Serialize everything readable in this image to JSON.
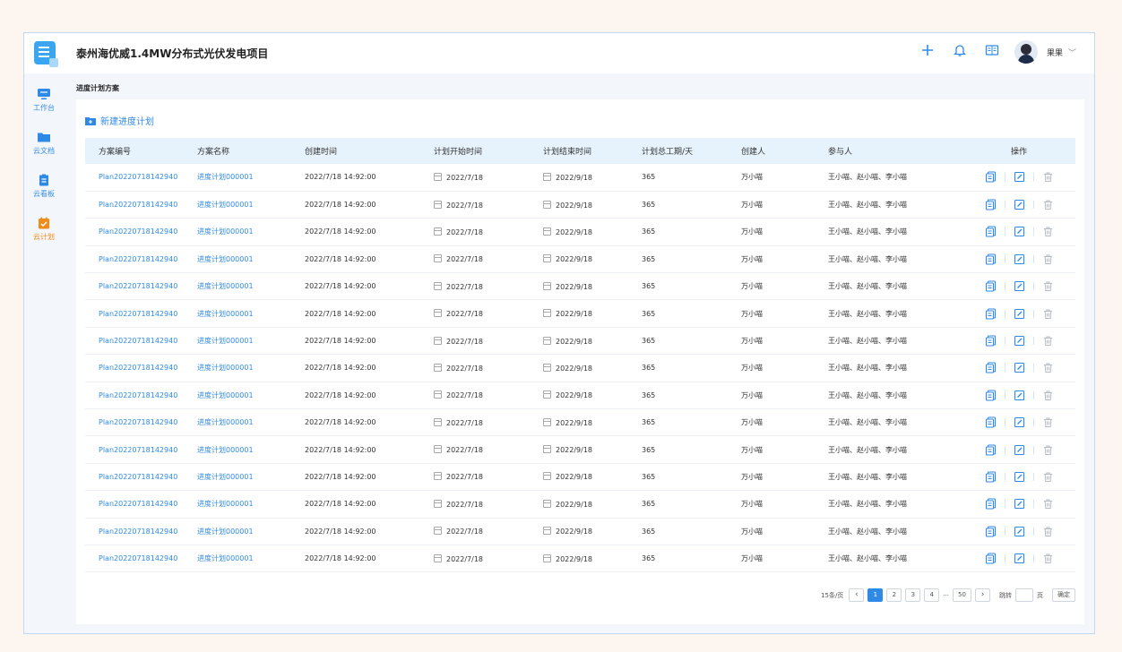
{
  "header": {
    "project_title": "泰州海优威1.4MW分布式光伏发电项目",
    "user_name": "果果"
  },
  "sidebar": {
    "items": [
      {
        "label": "工作台",
        "icon": "monitor-icon",
        "active": false
      },
      {
        "label": "云文档",
        "icon": "folder-icon",
        "active": false
      },
      {
        "label": "云看板",
        "icon": "clipboard-icon",
        "active": false
      },
      {
        "label": "云计划",
        "icon": "calendar-check-icon",
        "active": true
      }
    ]
  },
  "breadcrumb": "进度计划方案",
  "new_plan_label": "新建进度计划",
  "table": {
    "columns": [
      "方案编号",
      "方案名称",
      "创建时间",
      "计划开始时间",
      "计划结束时间",
      "计划总工期/天",
      "创建人",
      "参与人",
      "操作"
    ],
    "rows": [
      {
        "id": "Plan20220718142940",
        "name": "进度计划000001",
        "created": "2022/7/18  14:92:00",
        "start": "2022/7/18",
        "end": "2022/9/18",
        "duration": "365",
        "creator": "万小喵",
        "participants": "王小喵、赵小喵、李小喵"
      },
      {
        "id": "Plan20220718142940",
        "name": "进度计划000001",
        "created": "2022/7/18  14:92:00",
        "start": "2022/7/18",
        "end": "2022/9/18",
        "duration": "365",
        "creator": "万小喵",
        "participants": "王小喵、赵小喵、李小喵"
      },
      {
        "id": "Plan20220718142940",
        "name": "进度计划000001",
        "created": "2022/7/18  14:92:00",
        "start": "2022/7/18",
        "end": "2022/9/18",
        "duration": "365",
        "creator": "万小喵",
        "participants": "王小喵、赵小喵、李小喵"
      },
      {
        "id": "Plan20220718142940",
        "name": "进度计划000001",
        "created": "2022/7/18  14:92:00",
        "start": "2022/7/18",
        "end": "2022/9/18",
        "duration": "365",
        "creator": "万小喵",
        "participants": "王小喵、赵小喵、李小喵"
      },
      {
        "id": "Plan20220718142940",
        "name": "进度计划000001",
        "created": "2022/7/18  14:92:00",
        "start": "2022/7/18",
        "end": "2022/9/18",
        "duration": "365",
        "creator": "万小喵",
        "participants": "王小喵、赵小喵、李小喵"
      },
      {
        "id": "Plan20220718142940",
        "name": "进度计划000001",
        "created": "2022/7/18  14:92:00",
        "start": "2022/7/18",
        "end": "2022/9/18",
        "duration": "365",
        "creator": "万小喵",
        "participants": "王小喵、赵小喵、李小喵"
      },
      {
        "id": "Plan20220718142940",
        "name": "进度计划000001",
        "created": "2022/7/18  14:92:00",
        "start": "2022/7/18",
        "end": "2022/9/18",
        "duration": "365",
        "creator": "万小喵",
        "participants": "王小喵、赵小喵、李小喵"
      },
      {
        "id": "Plan20220718142940",
        "name": "进度计划000001",
        "created": "2022/7/18  14:92:00",
        "start": "2022/7/18",
        "end": "2022/9/18",
        "duration": "365",
        "creator": "万小喵",
        "participants": "王小喵、赵小喵、李小喵"
      },
      {
        "id": "Plan20220718142940",
        "name": "进度计划000001",
        "created": "2022/7/18  14:92:00",
        "start": "2022/7/18",
        "end": "2022/9/18",
        "duration": "365",
        "creator": "万小喵",
        "participants": "王小喵、赵小喵、李小喵"
      },
      {
        "id": "Plan20220718142940",
        "name": "进度计划000001",
        "created": "2022/7/18  14:92:00",
        "start": "2022/7/18",
        "end": "2022/9/18",
        "duration": "365",
        "creator": "万小喵",
        "participants": "王小喵、赵小喵、李小喵"
      },
      {
        "id": "Plan20220718142940",
        "name": "进度计划000001",
        "created": "2022/7/18  14:92:00",
        "start": "2022/7/18",
        "end": "2022/9/18",
        "duration": "365",
        "creator": "万小喵",
        "participants": "王小喵、赵小喵、李小喵"
      },
      {
        "id": "Plan20220718142940",
        "name": "进度计划000001",
        "created": "2022/7/18  14:92:00",
        "start": "2022/7/18",
        "end": "2022/9/18",
        "duration": "365",
        "creator": "万小喵",
        "participants": "王小喵、赵小喵、李小喵"
      },
      {
        "id": "Plan20220718142940",
        "name": "进度计划000001",
        "created": "2022/7/18  14:92:00",
        "start": "2022/7/18",
        "end": "2022/9/18",
        "duration": "365",
        "creator": "万小喵",
        "participants": "王小喵、赵小喵、李小喵"
      },
      {
        "id": "Plan20220718142940",
        "name": "进度计划000001",
        "created": "2022/7/18  14:92:00",
        "start": "2022/7/18",
        "end": "2022/9/18",
        "duration": "365",
        "creator": "万小喵",
        "participants": "王小喵、赵小喵、李小喵"
      },
      {
        "id": "Plan20220718142940",
        "name": "进度计划000001",
        "created": "2022/7/18  14:92:00",
        "start": "2022/7/18",
        "end": "2022/9/18",
        "duration": "365",
        "creator": "万小喵",
        "participants": "王小喵、赵小喵、李小喵"
      }
    ]
  },
  "pagination": {
    "page_size_label": "15条/页",
    "pages": [
      "1",
      "2",
      "3",
      "4"
    ],
    "ellipsis": "···",
    "last_page": "50",
    "current": "1",
    "jump_label": "跳转",
    "page_unit": "页",
    "confirm_label": "确定"
  },
  "colors": {
    "accent": "#2f8ae6",
    "active_nav": "#f08c1a",
    "header_row": "#e6f3fc"
  }
}
